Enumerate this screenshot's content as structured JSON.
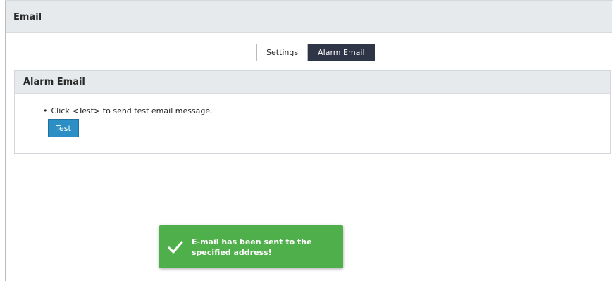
{
  "header": {
    "title": "Email"
  },
  "tabs": [
    {
      "label": "Settings",
      "active": false
    },
    {
      "label": "Alarm Email",
      "active": true
    }
  ],
  "panel": {
    "title": "Alarm Email",
    "instruction": "Click <Test> to send test email message.",
    "test_button": "Test"
  },
  "toast": {
    "message_line1": "E-mail has been sent to the",
    "message_line2": "specified address!",
    "icon": "check-icon"
  },
  "colors": {
    "header_bg": "#e7eaed",
    "active_tab": "#2d3546",
    "button": "#2b8fc6",
    "toast": "#4faf4b"
  }
}
